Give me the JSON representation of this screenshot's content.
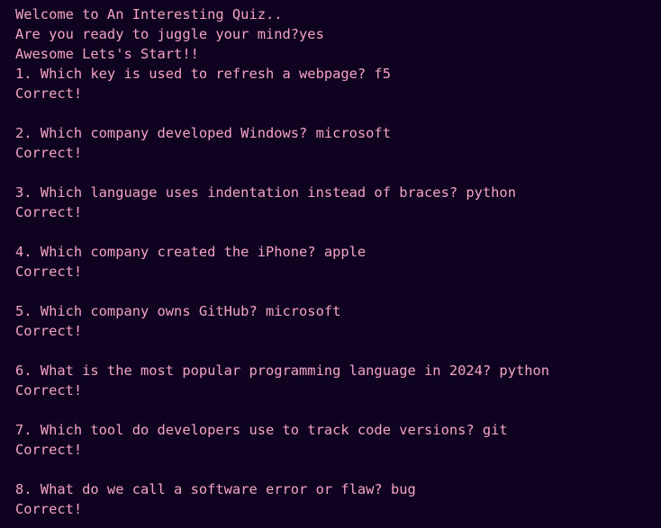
{
  "terminal": {
    "intro": [
      "Welcome to An Interesting Quiz..",
      "Are you ready to juggle your mind?yes",
      "Awesome Lets's Start!!"
    ],
    "qa": [
      {
        "question": "1. Which key is used to refresh a webpage? f5",
        "result": "Correct!"
      },
      {
        "question": "2. Which company developed Windows? microsoft",
        "result": "Correct!"
      },
      {
        "question": "3. Which language uses indentation instead of braces? python",
        "result": "Correct!"
      },
      {
        "question": "4. Which company created the iPhone? apple",
        "result": "Correct!"
      },
      {
        "question": "5. Which company owns GitHub? microsoft",
        "result": "Correct!"
      },
      {
        "question": "6. What is the most popular programming language in 2024? python",
        "result": "Correct!"
      },
      {
        "question": "7. Which tool do developers use to track code versions? git",
        "result": "Correct!"
      },
      {
        "question": "8. What do we call a software error or flaw? bug",
        "result": "Correct!"
      }
    ],
    "colors": {
      "background": "#0f0221",
      "text": "#f4a3c2"
    }
  }
}
